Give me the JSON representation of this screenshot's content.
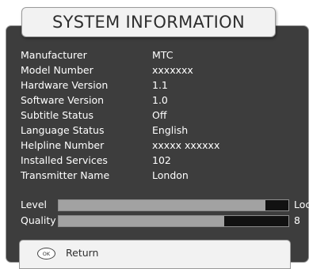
{
  "title": "SYSTEM INFORMATION",
  "info": [
    {
      "label": "Manufacturer",
      "value": "MTC"
    },
    {
      "label": "Model Number",
      "value": "xxxxxxx"
    },
    {
      "label": "Hardware Version",
      "value": "1.1"
    },
    {
      "label": "Software Version",
      "value": "1.0"
    },
    {
      "label": "Subtitle Status",
      "value": "Off"
    },
    {
      "label": "Language Status",
      "value": "English"
    },
    {
      "label": "Helpline Number",
      "value": "xxxxx xxxxxx"
    },
    {
      "label": "Installed Services",
      "value": "102"
    },
    {
      "label": "Transmitter Name",
      "value": "London"
    }
  ],
  "signal": {
    "level": {
      "label": "Level",
      "fill_fraction": 0.9,
      "status": "Lock"
    },
    "quality": {
      "label": "Quality",
      "fill_fraction": 0.72,
      "status": "8"
    }
  },
  "footer": {
    "ok_icon_text": "OK",
    "return_label": "Return"
  },
  "colors": {
    "panel": "#3d3d3d",
    "tab": "#f2f2f2",
    "bar_fill": "#a2a2a2",
    "bar_track": "#111111"
  }
}
